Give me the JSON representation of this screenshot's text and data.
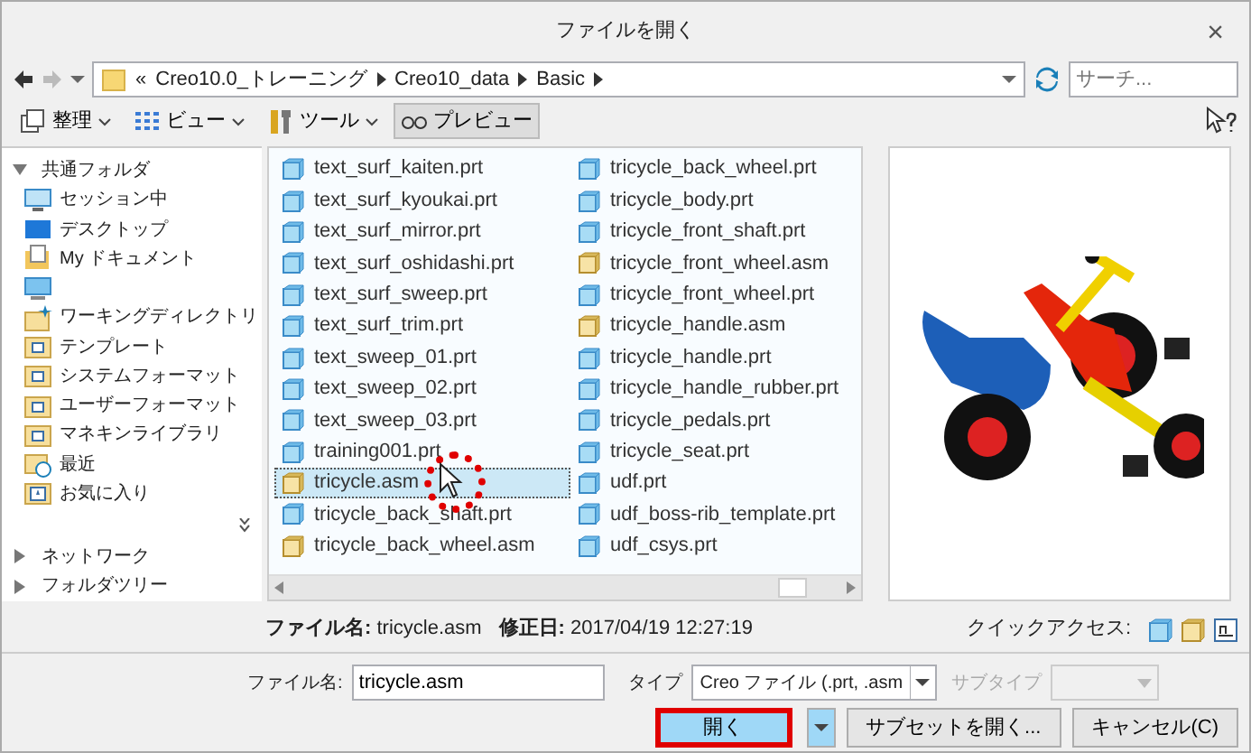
{
  "window": {
    "title": "ファイルを開く",
    "close": "×"
  },
  "address": {
    "overflow": "«",
    "path": [
      "Creo10.0_トレーニング",
      "Creo10_data",
      "Basic"
    ]
  },
  "search": {
    "placeholder": "サーチ..."
  },
  "toolbar": [
    {
      "label": "整理",
      "kind": "organize",
      "dropdown": true,
      "selected": false
    },
    {
      "label": "ビュー",
      "kind": "view",
      "dropdown": true,
      "selected": false
    },
    {
      "label": "ツール",
      "kind": "tools",
      "dropdown": true,
      "selected": false
    },
    {
      "label": "プレビュー",
      "kind": "preview",
      "dropdown": false,
      "selected": true
    }
  ],
  "sidebar": [
    {
      "label": "共通フォルダ",
      "expanded": true,
      "items": [
        {
          "label": "セッション中",
          "kind": "session"
        },
        {
          "label": "デスクトップ",
          "kind": "desktop"
        },
        {
          "label": "My ドキュメント",
          "kind": "documents"
        },
        {
          "kind": "computer"
        },
        {
          "label": "ワーキングディレクトリ",
          "kind": "workdir"
        },
        {
          "label": "テンプレート",
          "kind": "folder"
        },
        {
          "label": "システムフォーマット",
          "kind": "folder"
        },
        {
          "label": "ユーザーフォーマット",
          "kind": "folder"
        },
        {
          "label": "マネキンライブラリ",
          "kind": "folder"
        },
        {
          "label": "最近",
          "kind": "recent"
        },
        {
          "label": "お気に入り",
          "kind": "favorites"
        }
      ]
    },
    {
      "label": "ネットワーク",
      "expanded": false
    },
    {
      "label": "フォルダツリー",
      "expanded": false
    }
  ],
  "files": [
    {
      "name": "text_surf_kaiten.prt",
      "kind": "prt",
      "selected": false
    },
    {
      "name": "text_surf_kyoukai.prt",
      "kind": "prt",
      "selected": false
    },
    {
      "name": "text_surf_mirror.prt",
      "kind": "prt",
      "selected": false
    },
    {
      "name": "text_surf_oshidashi.prt",
      "kind": "prt",
      "selected": false
    },
    {
      "name": "text_surf_sweep.prt",
      "kind": "prt",
      "selected": false
    },
    {
      "name": "text_surf_trim.prt",
      "kind": "prt",
      "selected": false
    },
    {
      "name": "text_sweep_01.prt",
      "kind": "prt",
      "selected": false
    },
    {
      "name": "text_sweep_02.prt",
      "kind": "prt",
      "selected": false
    },
    {
      "name": "text_sweep_03.prt",
      "kind": "prt",
      "selected": false
    },
    {
      "name": "training001.prt",
      "kind": "prt",
      "selected": false
    },
    {
      "name": "tricycle.asm",
      "kind": "asm",
      "selected": true
    },
    {
      "name": "tricycle_back_shaft.prt",
      "kind": "prt",
      "selected": false
    },
    {
      "name": "tricycle_back_wheel.asm",
      "kind": "asm",
      "selected": false
    },
    {
      "name": "tricycle_back_wheel.prt",
      "kind": "prt",
      "selected": false
    },
    {
      "name": "tricycle_body.prt",
      "kind": "prt",
      "selected": false
    },
    {
      "name": "tricycle_front_shaft.prt",
      "kind": "prt",
      "selected": false
    },
    {
      "name": "tricycle_front_wheel.asm",
      "kind": "asm",
      "selected": false
    },
    {
      "name": "tricycle_front_wheel.prt",
      "kind": "prt",
      "selected": false
    },
    {
      "name": "tricycle_handle.asm",
      "kind": "asm",
      "selected": false
    },
    {
      "name": "tricycle_handle.prt",
      "kind": "prt",
      "selected": false
    },
    {
      "name": "tricycle_handle_rubber.prt",
      "kind": "prt",
      "selected": false
    },
    {
      "name": "tricycle_pedals.prt",
      "kind": "prt",
      "selected": false
    },
    {
      "name": "tricycle_seat.prt",
      "kind": "prt",
      "selected": false
    },
    {
      "name": "udf.prt",
      "kind": "prt",
      "selected": false
    },
    {
      "name": "udf_boss-rib_template.prt",
      "kind": "prt",
      "selected": false
    },
    {
      "name": "udf_csys.prt",
      "kind": "prt",
      "selected": false
    }
  ],
  "info": {
    "filename_label": "ファイル名:",
    "filename": "tricycle.asm",
    "modified_label": "修正日:",
    "modified": "2017/04/19 12:27:19",
    "quick_access_label": "クイックアクセス:"
  },
  "form": {
    "filename_label": "ファイル名:",
    "filename_value": "tricycle.asm",
    "type_label": "タイプ",
    "type_value": "Creo ファイル (.prt, .asm",
    "subtype_label": "サブタイプ",
    "subtype_disabled": true
  },
  "buttons": [
    {
      "label": "開く",
      "kind": "primary",
      "highlighted": true
    },
    {
      "kind": "split"
    },
    {
      "label": "サブセットを開く...",
      "kind": "normal"
    },
    {
      "label": "キャンセル(C)",
      "kind": "normal"
    }
  ]
}
